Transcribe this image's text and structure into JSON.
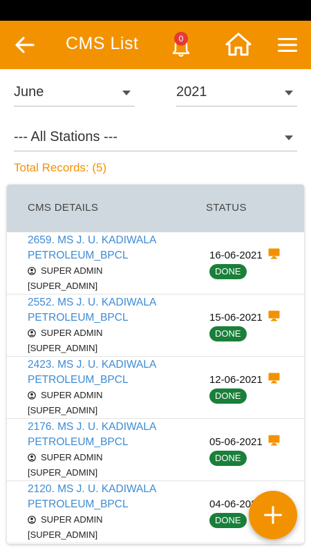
{
  "header": {
    "title": "CMS List",
    "notification_count": "0",
    "icons": [
      "back-arrow-icon",
      "bell-icon",
      "home-icon",
      "hamburger-menu-icon"
    ],
    "accent_color": "#f39200"
  },
  "filters": {
    "month": "June",
    "year": "2021",
    "station": "--- All Stations ---"
  },
  "total_records": "Total Records: (5)",
  "table": {
    "columns": [
      "CMS DETAILS",
      "STATUS"
    ],
    "rows": [
      {
        "name_line1": "2659. MS J. U. KADIWALA",
        "name_line2": "PETROLEUM_BPCL",
        "role": "SUPER ADMIN",
        "role_code": "[SUPER_ADMIN]",
        "date": "16-06-2021",
        "status": "DONE"
      },
      {
        "name_line1": "2552. MS J. U. KADIWALA",
        "name_line2": "PETROLEUM_BPCL",
        "role": "SUPER ADMIN",
        "role_code": "[SUPER_ADMIN]",
        "date": "15-06-2021",
        "status": "DONE"
      },
      {
        "name_line1": "2423. MS J. U. KADIWALA",
        "name_line2": "PETROLEUM_BPCL",
        "role": "SUPER ADMIN",
        "role_code": "[SUPER_ADMIN]",
        "date": "12-06-2021",
        "status": "DONE"
      },
      {
        "name_line1": "2176. MS J. U. KADIWALA",
        "name_line2": "PETROLEUM_BPCL",
        "role": "SUPER ADMIN",
        "role_code": "[SUPER_ADMIN]",
        "date": "05-06-2021",
        "status": "DONE"
      },
      {
        "name_line1": "2120. MS J. U. KADIWALA",
        "name_line2": "PETROLEUM_BPCL",
        "role": "SUPER ADMIN",
        "role_code": "[SUPER_ADMIN]",
        "date": "04-06-2021",
        "status": "DONE"
      }
    ]
  },
  "fab": {
    "icon": "plus-icon"
  }
}
